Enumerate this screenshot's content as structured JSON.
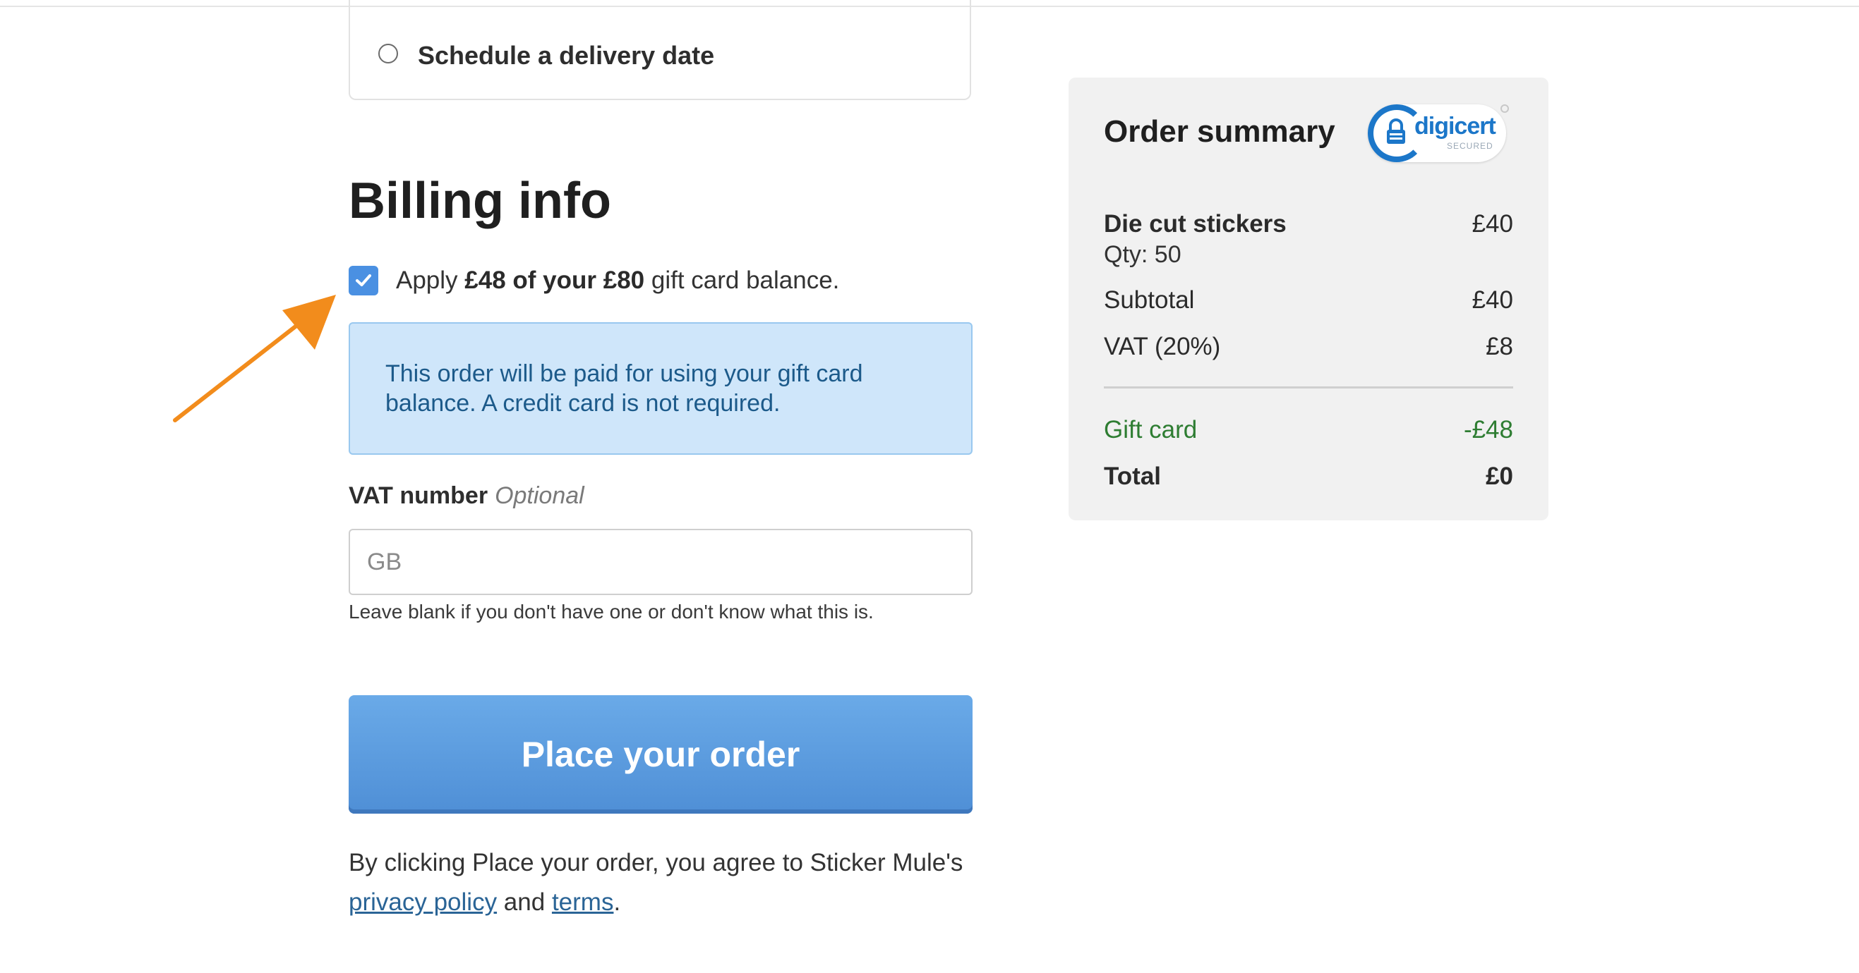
{
  "delivery": {
    "schedule_label": "Schedule a delivery date"
  },
  "billing": {
    "title": "Billing info",
    "gift_card": {
      "prefix": "Apply ",
      "bold": "£48 of your £80",
      "suffix": " gift card balance.",
      "checked": true
    },
    "info_message": "This order will be paid for using your gift card balance. A credit card is not required.",
    "vat": {
      "label": "VAT number",
      "optional_label": "Optional",
      "placeholder": "GB",
      "value": "",
      "help": "Leave blank if you don't have one or don't know what this is."
    },
    "place_order_label": "Place your order",
    "agreement": {
      "prefix": "By clicking Place your order, you agree to Sticker Mule's ",
      "privacy_link": "privacy policy",
      "and": " and ",
      "terms_link": "terms",
      "suffix": "."
    }
  },
  "summary": {
    "title": "Order summary",
    "badge": {
      "brand": "digicert",
      "sub": "SECURED"
    },
    "item": {
      "name": "Die cut stickers",
      "qty": "Qty: 50",
      "price": "£40"
    },
    "subtotal": {
      "label": "Subtotal",
      "value": "£40"
    },
    "vat": {
      "label": "VAT (20%)",
      "value": "£8"
    },
    "gift_card": {
      "label": "Gift card",
      "value": "-£48"
    },
    "total": {
      "label": "Total",
      "value": "£0"
    }
  },
  "colors": {
    "accent": "#4a90e2",
    "info_bg": "#cfe6fa",
    "info_text": "#1c5a8a",
    "gift_green": "#2e7d32",
    "arrow": "#f28c1c"
  },
  "icons": [
    "radio-unchecked-icon",
    "checkmark-icon",
    "lock-icon",
    "annotation-arrow-icon"
  ]
}
